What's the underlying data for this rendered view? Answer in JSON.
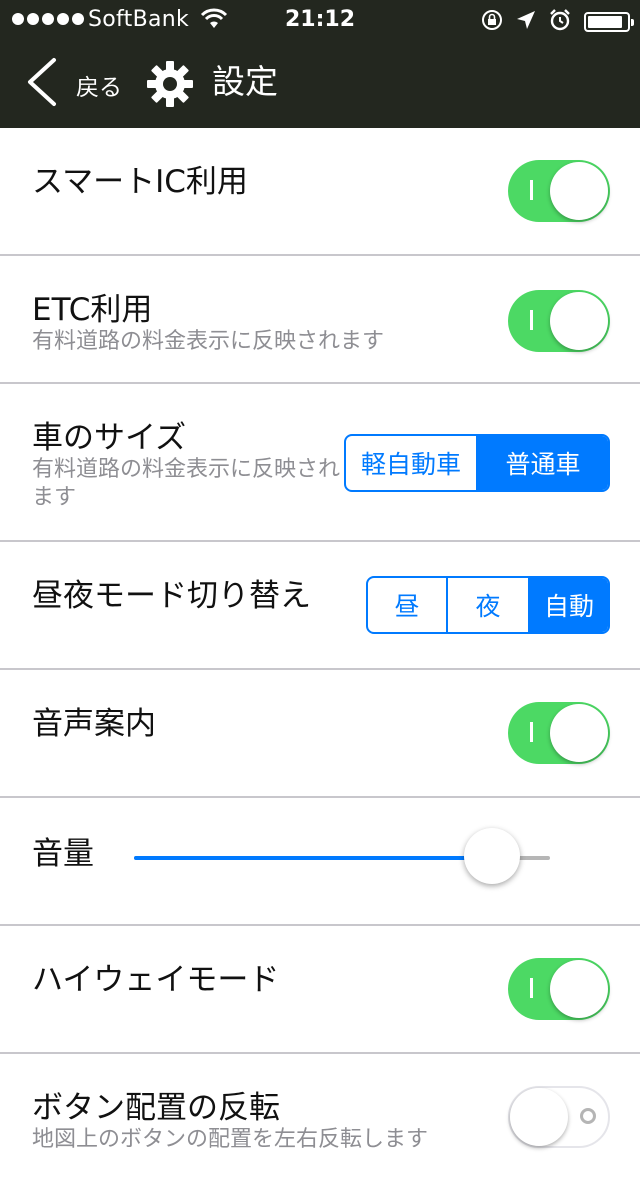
{
  "status_bar": {
    "carrier": "SoftBank",
    "time": "21:12",
    "battery_level": 0.9,
    "signal_dots": 5
  },
  "nav": {
    "back_label": "戻る",
    "title": "設定",
    "icons": [
      "chevron-left-icon",
      "gear-icon"
    ]
  },
  "settings": {
    "smart_ic": {
      "label": "スマートIC利用",
      "enabled": true
    },
    "etc": {
      "label": "ETC利用",
      "description": "有料道路の料金表示に反映されます",
      "enabled": true
    },
    "car_size": {
      "label": "車のサイズ",
      "description": "有料道路の料金表示に反映されます",
      "options": [
        "軽自動車",
        "普通車"
      ],
      "selected": "普通車"
    },
    "day_night": {
      "label": "昼夜モード切り替え",
      "options": [
        "昼",
        "夜",
        "自動"
      ],
      "selected": "自動"
    },
    "voice_guidance": {
      "label": "音声案内",
      "enabled": true
    },
    "volume": {
      "label": "音量",
      "level": 0.86
    },
    "highway_mode": {
      "label": "ハイウェイモード",
      "enabled": true
    },
    "button_flip": {
      "label": "ボタン配置の反転",
      "description": "地図上のボタンの配置を左右反転します",
      "enabled": false
    }
  },
  "colors": {
    "header_bg": "#23271f",
    "toggle_on": "#4cd964",
    "accent": "#007aff",
    "separator": "#c8c7cc",
    "subtext": "#8e8e93"
  }
}
